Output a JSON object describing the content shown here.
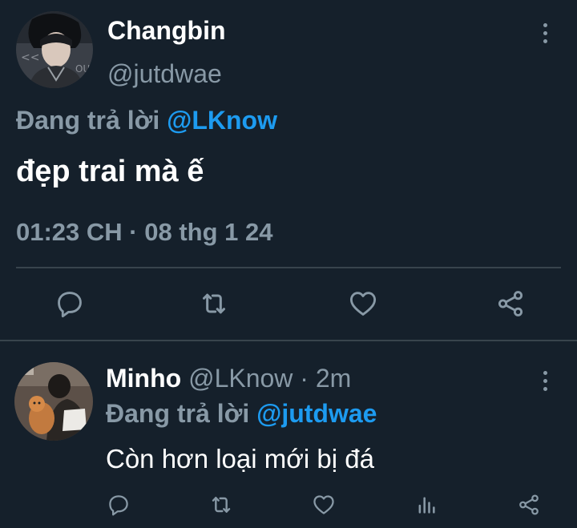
{
  "main_tweet": {
    "author_name": "Changbin",
    "author_handle": "@jutdwae",
    "replying_prefix": "Đang trả lời",
    "replying_to": "@LKnow",
    "text": "đẹp trai mà ế",
    "timestamp": "01:23 CH · 08 thg 1 24",
    "actions": [
      "reply-icon",
      "retweet-icon",
      "like-icon",
      "share-icon"
    ]
  },
  "reply_tweet": {
    "author_name": "Minho",
    "author_handle": "@LKnow",
    "separator": " · ",
    "time_ago": "2m",
    "replying_prefix": "Đang trả lời",
    "replying_to": "@jutdwae",
    "text": "Còn hơn loại mới bị đá",
    "actions": [
      "reply-icon",
      "retweet-icon",
      "like-icon",
      "analytics-icon",
      "share-icon"
    ]
  },
  "colors": {
    "background": "#15202b",
    "primary_text": "#ffffff",
    "secondary_text": "#8899a6",
    "accent": "#1d9bf0",
    "divider": "#38444d"
  }
}
